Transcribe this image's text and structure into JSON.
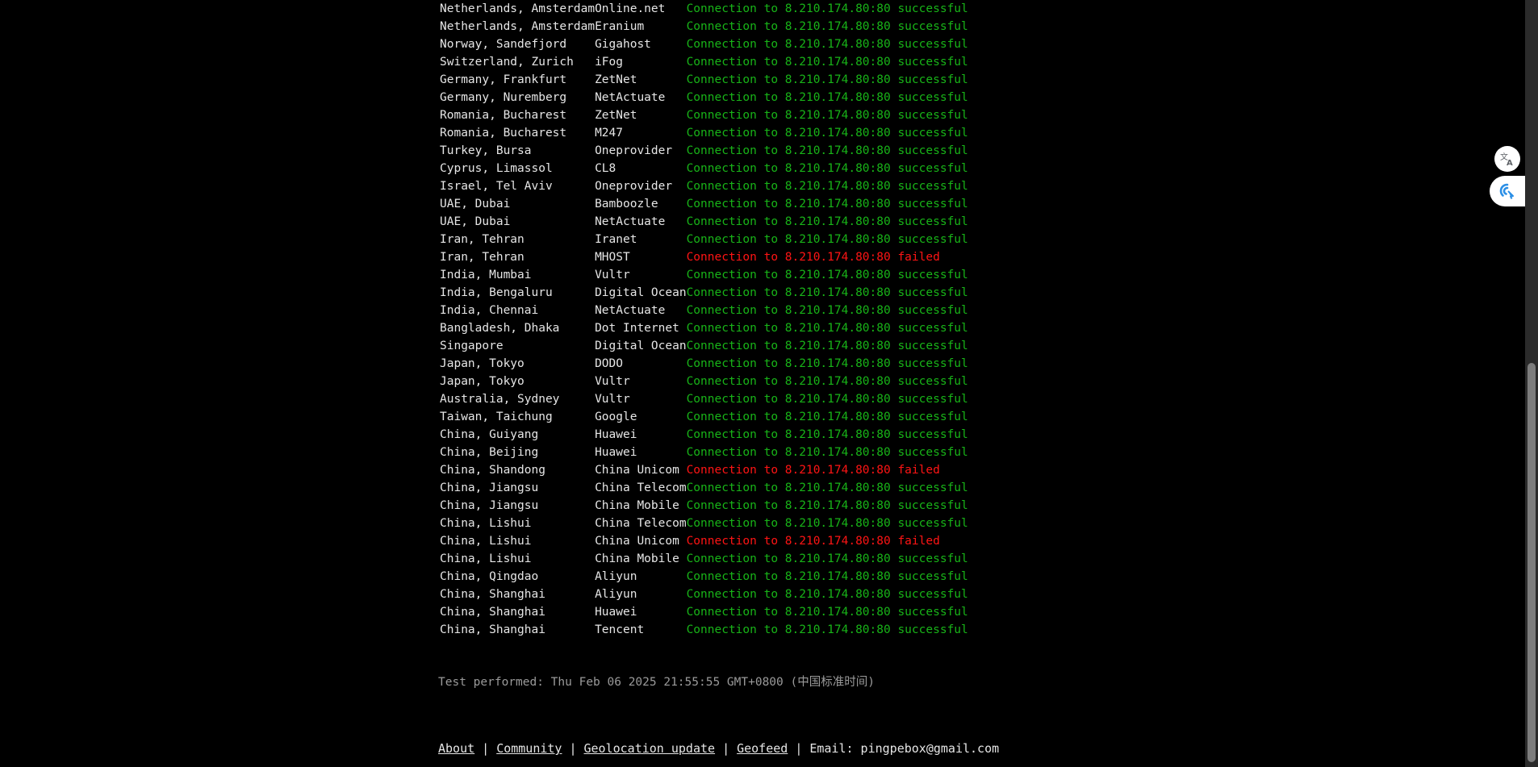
{
  "results": [
    {
      "location": "Netherlands, Amsterdam",
      "provider": "Online.net",
      "status": "ok",
      "message": "Connection to 8.210.174.80:80 successful"
    },
    {
      "location": "Netherlands, Amsterdam",
      "provider": "Eranium",
      "status": "ok",
      "message": "Connection to 8.210.174.80:80 successful"
    },
    {
      "location": "Norway, Sandefjord",
      "provider": "Gigahost",
      "status": "ok",
      "message": "Connection to 8.210.174.80:80 successful"
    },
    {
      "location": "Switzerland, Zurich",
      "provider": "iFog",
      "status": "ok",
      "message": "Connection to 8.210.174.80:80 successful"
    },
    {
      "location": "Germany, Frankfurt",
      "provider": "ZetNet",
      "status": "ok",
      "message": "Connection to 8.210.174.80:80 successful"
    },
    {
      "location": "Germany, Nuremberg",
      "provider": "NetActuate",
      "status": "ok",
      "message": "Connection to 8.210.174.80:80 successful"
    },
    {
      "location": "Romania, Bucharest",
      "provider": "ZetNet",
      "status": "ok",
      "message": "Connection to 8.210.174.80:80 successful"
    },
    {
      "location": "Romania, Bucharest",
      "provider": "M247",
      "status": "ok",
      "message": "Connection to 8.210.174.80:80 successful"
    },
    {
      "location": "Turkey, Bursa",
      "provider": "Oneprovider",
      "status": "ok",
      "message": "Connection to 8.210.174.80:80 successful"
    },
    {
      "location": "Cyprus, Limassol",
      "provider": "CL8",
      "status": "ok",
      "message": "Connection to 8.210.174.80:80 successful"
    },
    {
      "location": "Israel, Tel Aviv",
      "provider": "Oneprovider",
      "status": "ok",
      "message": "Connection to 8.210.174.80:80 successful"
    },
    {
      "location": "UAE, Dubai",
      "provider": "Bamboozle",
      "status": "ok",
      "message": "Connection to 8.210.174.80:80 successful"
    },
    {
      "location": "UAE, Dubai",
      "provider": "NetActuate",
      "status": "ok",
      "message": "Connection to 8.210.174.80:80 successful"
    },
    {
      "location": "Iran, Tehran",
      "provider": "Iranet",
      "status": "ok",
      "message": "Connection to 8.210.174.80:80 successful"
    },
    {
      "location": "Iran, Tehran",
      "provider": "MHOST",
      "status": "fail",
      "message": "Connection to 8.210.174.80:80 failed"
    },
    {
      "location": "India, Mumbai",
      "provider": "Vultr",
      "status": "ok",
      "message": "Connection to 8.210.174.80:80 successful"
    },
    {
      "location": "India, Bengaluru",
      "provider": "Digital Ocean",
      "status": "ok",
      "message": "Connection to 8.210.174.80:80 successful"
    },
    {
      "location": "India, Chennai",
      "provider": "NetActuate",
      "status": "ok",
      "message": "Connection to 8.210.174.80:80 successful"
    },
    {
      "location": "Bangladesh, Dhaka",
      "provider": "Dot Internet",
      "status": "ok",
      "message": "Connection to 8.210.174.80:80 successful"
    },
    {
      "location": "Singapore",
      "provider": "Digital Ocean",
      "status": "ok",
      "message": "Connection to 8.210.174.80:80 successful"
    },
    {
      "location": "Japan, Tokyo",
      "provider": "DODO",
      "status": "ok",
      "message": "Connection to 8.210.174.80:80 successful"
    },
    {
      "location": "Japan, Tokyo",
      "provider": "Vultr",
      "status": "ok",
      "message": "Connection to 8.210.174.80:80 successful"
    },
    {
      "location": "Australia, Sydney",
      "provider": "Vultr",
      "status": "ok",
      "message": "Connection to 8.210.174.80:80 successful"
    },
    {
      "location": "Taiwan, Taichung",
      "provider": "Google",
      "status": "ok",
      "message": "Connection to 8.210.174.80:80 successful"
    },
    {
      "location": "China, Guiyang",
      "provider": "Huawei",
      "status": "ok",
      "message": "Connection to 8.210.174.80:80 successful"
    },
    {
      "location": "China, Beijing",
      "provider": "Huawei",
      "status": "ok",
      "message": "Connection to 8.210.174.80:80 successful"
    },
    {
      "location": "China, Shandong",
      "provider": "China Unicom",
      "status": "fail",
      "message": "Connection to 8.210.174.80:80 failed"
    },
    {
      "location": "China, Jiangsu",
      "provider": "China Telecom",
      "status": "ok",
      "message": "Connection to 8.210.174.80:80 successful"
    },
    {
      "location": "China, Jiangsu",
      "provider": "China Mobile",
      "status": "ok",
      "message": "Connection to 8.210.174.80:80 successful"
    },
    {
      "location": "China, Lishui",
      "provider": "China Telecom",
      "status": "ok",
      "message": "Connection to 8.210.174.80:80 successful"
    },
    {
      "location": "China, Lishui",
      "provider": "China Unicom",
      "status": "fail",
      "message": "Connection to 8.210.174.80:80 failed"
    },
    {
      "location": "China, Lishui",
      "provider": "China Mobile",
      "status": "ok",
      "message": "Connection to 8.210.174.80:80 successful"
    },
    {
      "location": "China, Qingdao",
      "provider": "Aliyun",
      "status": "ok",
      "message": "Connection to 8.210.174.80:80 successful"
    },
    {
      "location": "China, Shanghai",
      "provider": "Aliyun",
      "status": "ok",
      "message": "Connection to 8.210.174.80:80 successful"
    },
    {
      "location": "China, Shanghai",
      "provider": "Huawei",
      "status": "ok",
      "message": "Connection to 8.210.174.80:80 successful"
    },
    {
      "location": "China, Shanghai",
      "provider": "Tencent",
      "status": "ok",
      "message": "Connection to 8.210.174.80:80 successful"
    }
  ],
  "test_performed": "Test performed: Thu Feb 06 2025 21:55:55 GMT+0800 (中国标准时间)",
  "footer": {
    "about": "About",
    "community": "Community",
    "geolocation": "Geolocation update",
    "geofeed": "Geofeed",
    "separator": "|",
    "email": "Email: pingpebox@gmail.com"
  },
  "colors": {
    "background": "#000000",
    "success": "#18b418",
    "failure": "#ff1414",
    "text": "#e6e6e6",
    "muted": "#9a9a9a"
  },
  "icons": {
    "translate": "translate-icon",
    "assistant": "assistant-icon"
  }
}
